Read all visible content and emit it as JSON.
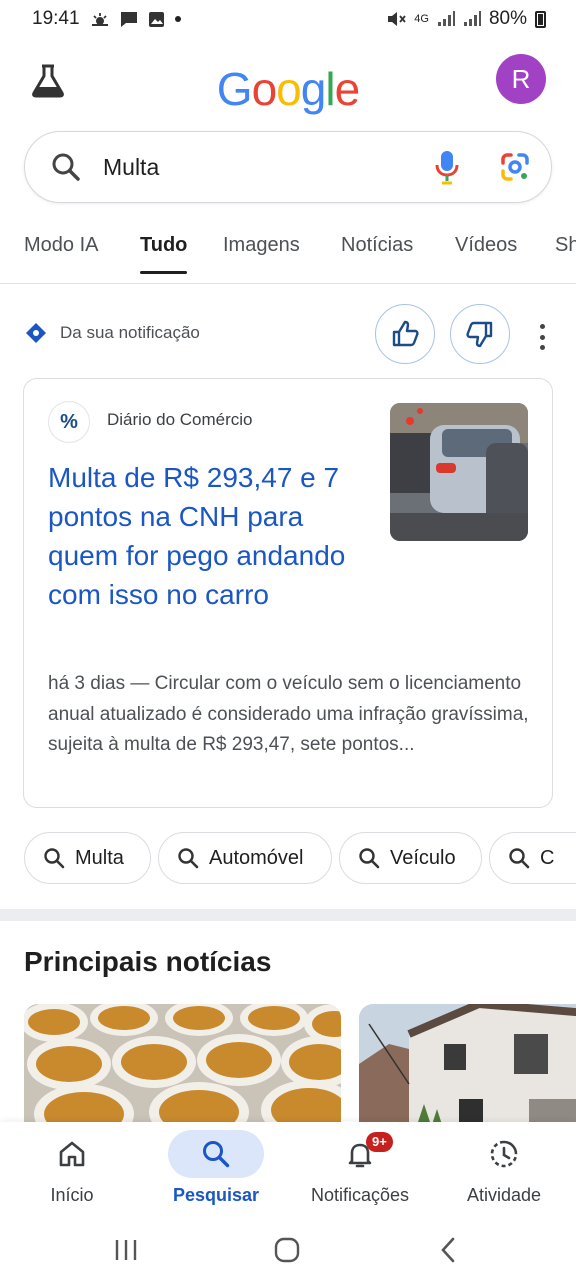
{
  "status_bar": {
    "time": "19:41",
    "network": "4G",
    "battery": "80%",
    "icons": [
      "weather-icon",
      "message-icon",
      "gallery-icon",
      "dot-icon",
      "mute-icon",
      "signal-icon",
      "battery-icon"
    ]
  },
  "header": {
    "logo_letters": [
      {
        "char": "G",
        "color": "#4285F4"
      },
      {
        "char": "o",
        "color": "#EA4335"
      },
      {
        "char": "o",
        "color": "#FBBC05"
      },
      {
        "char": "g",
        "color": "#4285F4"
      },
      {
        "char": "l",
        "color": "#34A853"
      },
      {
        "char": "e",
        "color": "#EA4335"
      }
    ],
    "avatar_initial": "R",
    "avatar_color": "#A142C4"
  },
  "search": {
    "value": "Multa"
  },
  "tabs": [
    {
      "label": "Modo IA",
      "active": false
    },
    {
      "label": "Tudo",
      "active": true
    },
    {
      "label": "Imagens",
      "active": false
    },
    {
      "label": "Notícias",
      "active": false
    },
    {
      "label": "Vídeos",
      "active": false
    },
    {
      "label": "Sh",
      "active": false
    }
  ],
  "notification": {
    "label": "Da sua notificação"
  },
  "card": {
    "source_logo": "%",
    "source_name": "Diário do Comércio",
    "title": "Multa de R$ 293,47 e 7 pontos na CNH para quem for pego andando com isso no carro",
    "snippet": "há 3 dias — Circular com o veículo sem o licenciamento anual atualizado é considerado uma infração gravíssima, sujeita à multa de R$ 293,47, sete pontos..."
  },
  "chips": [
    "Multa",
    "Automóvel",
    "Veículo",
    "C"
  ],
  "section": {
    "title": "Principais notícias"
  },
  "bottom_nav": [
    {
      "label": "Início",
      "icon": "home-icon",
      "active": false
    },
    {
      "label": "Pesquisar",
      "icon": "search-icon",
      "active": true
    },
    {
      "label": "Notificações",
      "icon": "bell-icon",
      "active": false,
      "badge": "9+"
    },
    {
      "label": "Atividade",
      "icon": "activity-icon",
      "active": false
    }
  ],
  "colors": {
    "link_blue": "#1A57C4",
    "accent_active_bg": "#DBE6FB",
    "badge_red": "#C5221F"
  }
}
